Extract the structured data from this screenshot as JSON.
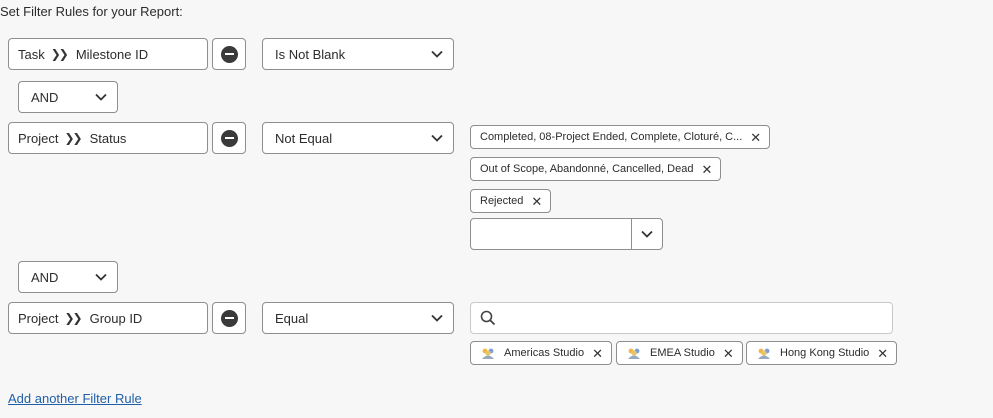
{
  "header": {
    "title": "Set Filter Rules for your Report:"
  },
  "rules": [
    {
      "entity": "Task",
      "field": "Milestone ID",
      "operator": "Is Not Blank"
    },
    {
      "entity": "Project",
      "field": "Status",
      "operator": "Not Equal",
      "values": [
        "Completed, 08-Project Ended, Complete, Cloturé, C...",
        "Out of Scope, Abandonné, Cancelled, Dead",
        "Rejected"
      ],
      "combo_value": ""
    },
    {
      "entity": "Project",
      "field": "Group ID",
      "operator": "Equal",
      "search_placeholder": "",
      "values": [
        "Americas Studio",
        "EMEA Studio",
        "Hong Kong Studio"
      ]
    }
  ],
  "connectors": [
    "AND",
    "AND"
  ],
  "add_rule_label": "Add another Filter Rule",
  "icons": [
    "double-chevron-icon",
    "remove-circle-icon",
    "chevron-down-icon",
    "close-icon",
    "search-icon",
    "group-avatar-icon"
  ]
}
